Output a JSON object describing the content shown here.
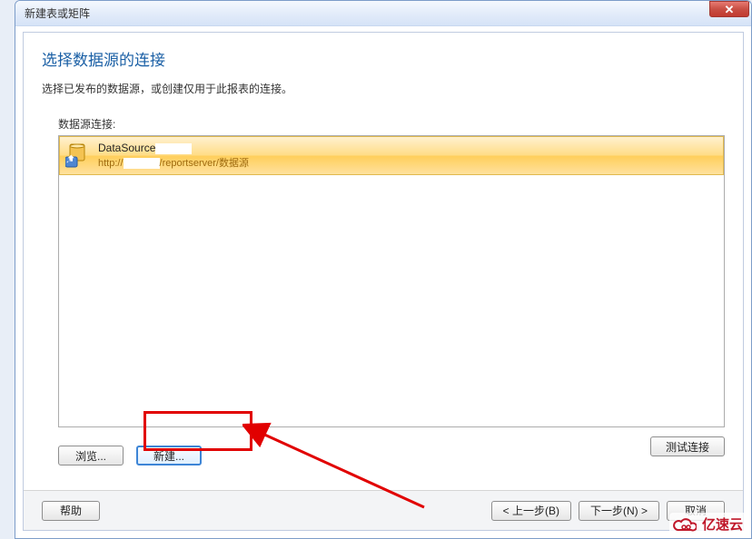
{
  "window": {
    "title": "新建表或矩阵"
  },
  "page": {
    "heading": "选择数据源的连接",
    "description": "选择已发布的数据源，或创建仅用于此报表的连接。",
    "list_label": "数据源连接:"
  },
  "datasource": {
    "name": "DataSource",
    "url_prefix": "http://",
    "url_suffix": "/reportserver/数据源"
  },
  "buttons": {
    "browse": "浏览...",
    "new": "新建...",
    "test": "测试连接",
    "help": "帮助",
    "back": "< 上一步(B)",
    "next": "下一步(N) >",
    "cancel": "取消"
  },
  "watermark": "亿速云"
}
